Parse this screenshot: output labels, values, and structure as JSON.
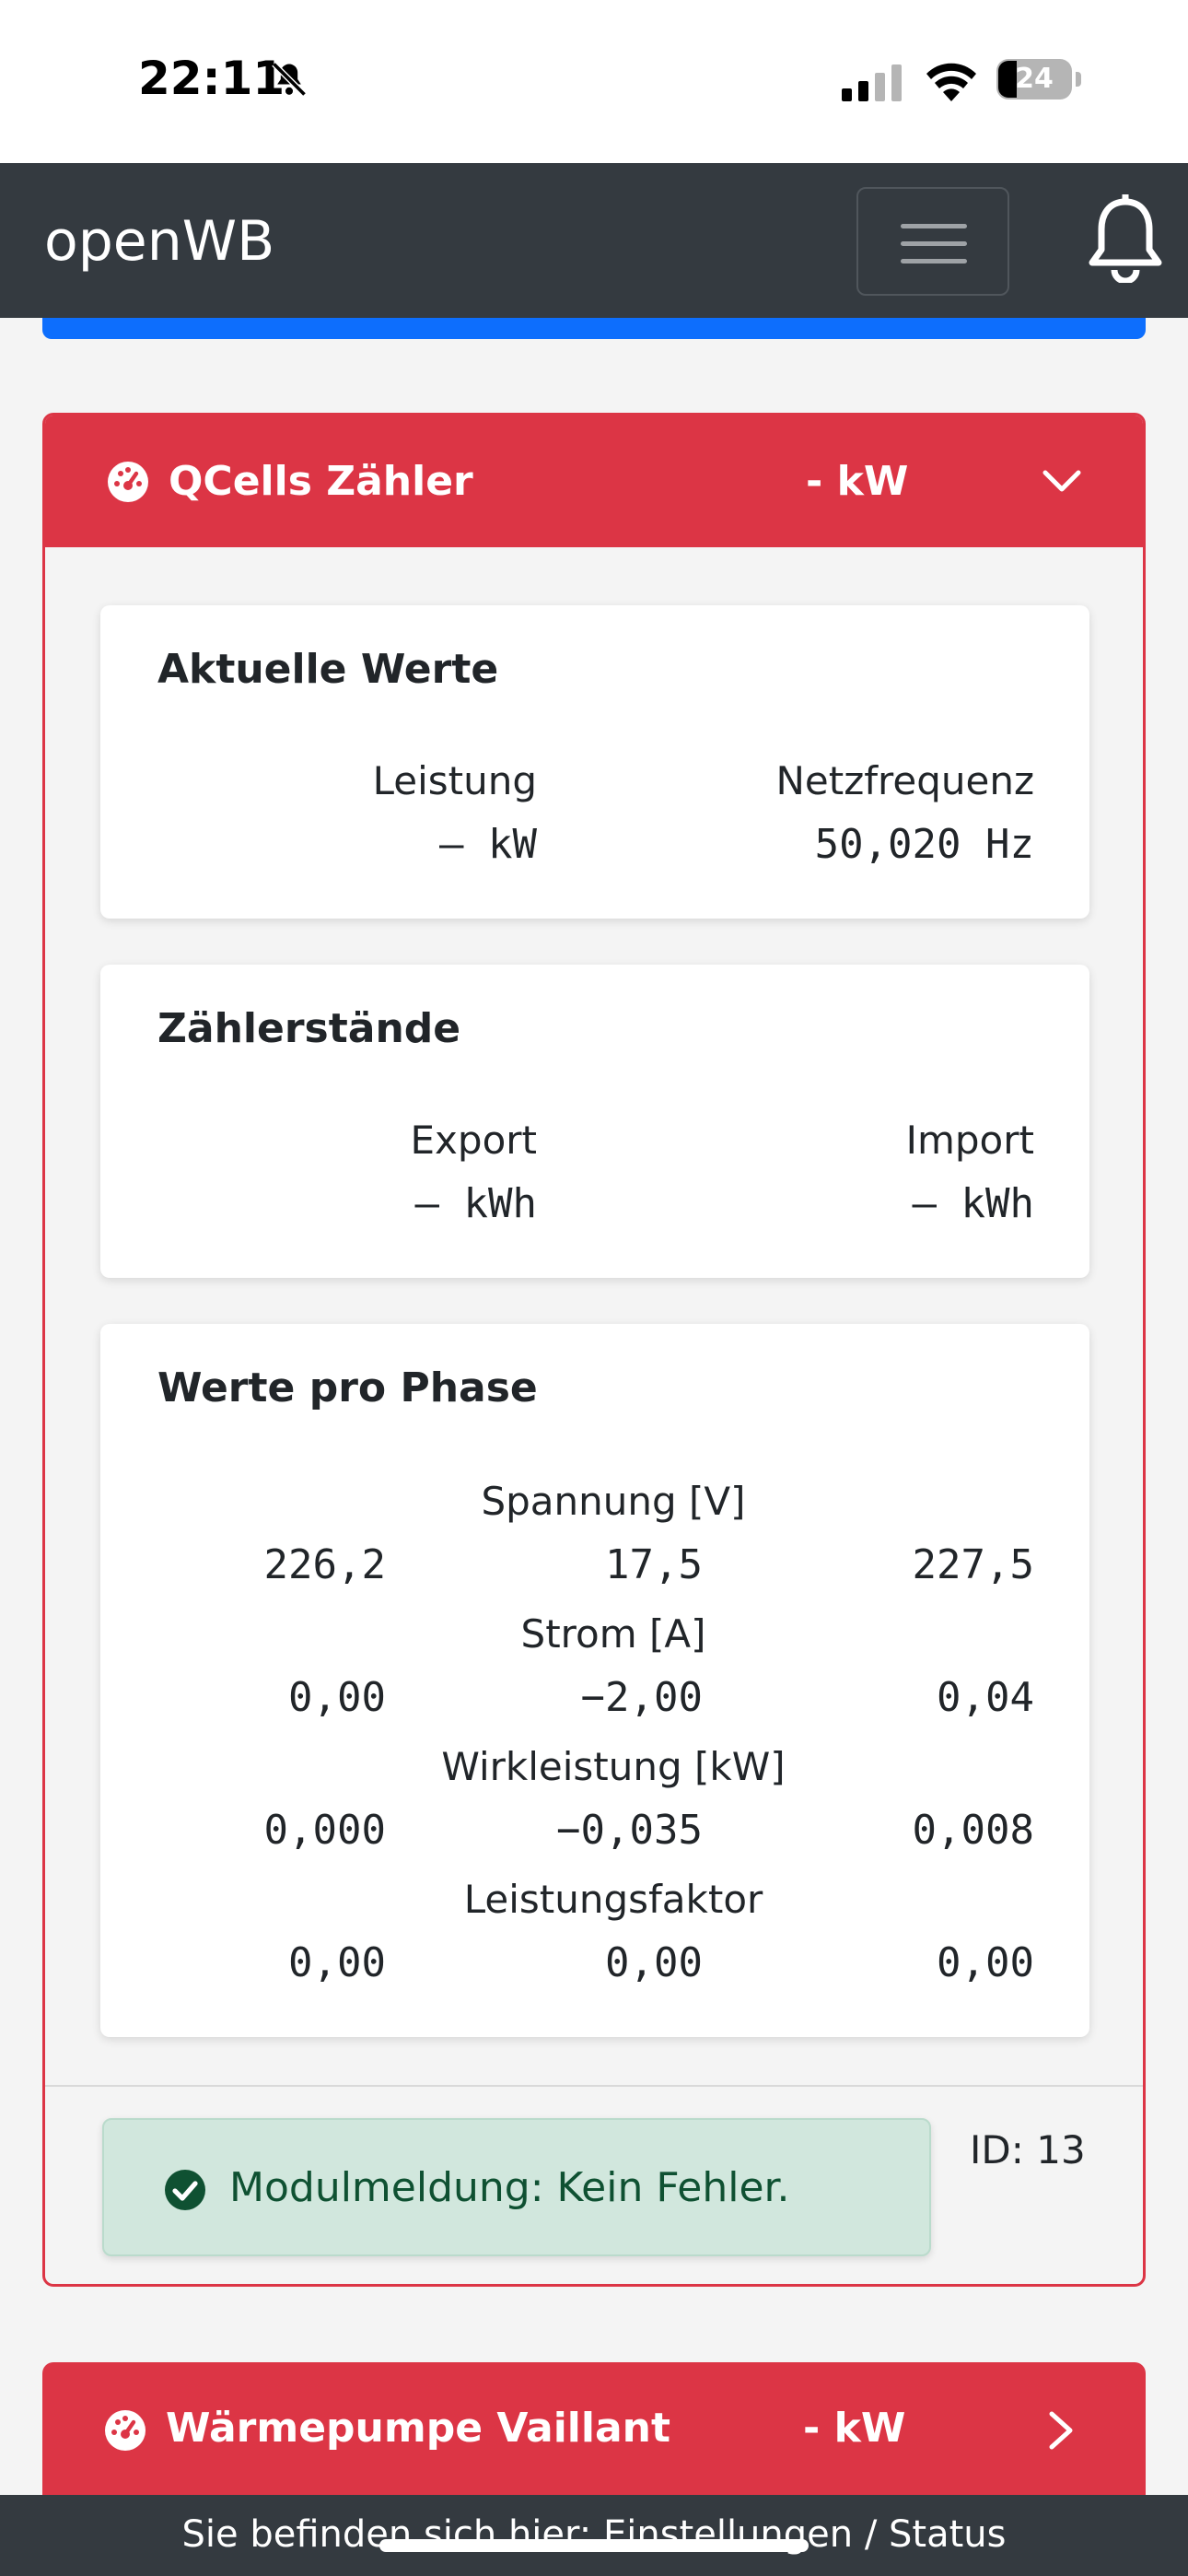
{
  "status_bar": {
    "time": "22:11",
    "battery": "24",
    "icons": [
      "bell-slash-icon",
      "signal-icon",
      "wifi-icon",
      "battery-icon"
    ]
  },
  "navbar": {
    "brand": "openWB",
    "icons": [
      "menu-icon",
      "bell-icon"
    ]
  },
  "card": {
    "title": "QCells Zähler",
    "power": "- kW",
    "accent_color": "#dc3545",
    "current_values": {
      "title": "Aktuelle Werte",
      "power_label": "Leistung",
      "power_value": "– kW",
      "frequency_label": "Netzfrequenz",
      "frequency_value": "50,020 Hz"
    },
    "counters": {
      "title": "Zählerstände",
      "export_label": "Export",
      "export_value": "– kWh",
      "import_label": "Import",
      "import_value": "– kWh"
    },
    "phases": {
      "title": "Werte pro Phase",
      "voltage_label": "Spannung [V]",
      "voltage": [
        "226,2",
        "17,5",
        "227,5"
      ],
      "current_label": "Strom [A]",
      "current": [
        "0,00",
        "−2,00",
        "0,04"
      ],
      "power_label": "Wirkleistung [kW]",
      "power": [
        "0,000",
        "−0,035",
        "0,008"
      ],
      "factor_label": "Leistungsfaktor",
      "factor": [
        "0,00",
        "0,00",
        "0,00"
      ]
    },
    "module_message": "Modulmeldung: Kein Fehler.",
    "id": "ID: 13"
  },
  "card2": {
    "title": "Wärmepumpe Vaillant",
    "power": "- kW"
  },
  "footer": {
    "text": "Sie befinden sich hier: Einstellungen / Status"
  }
}
